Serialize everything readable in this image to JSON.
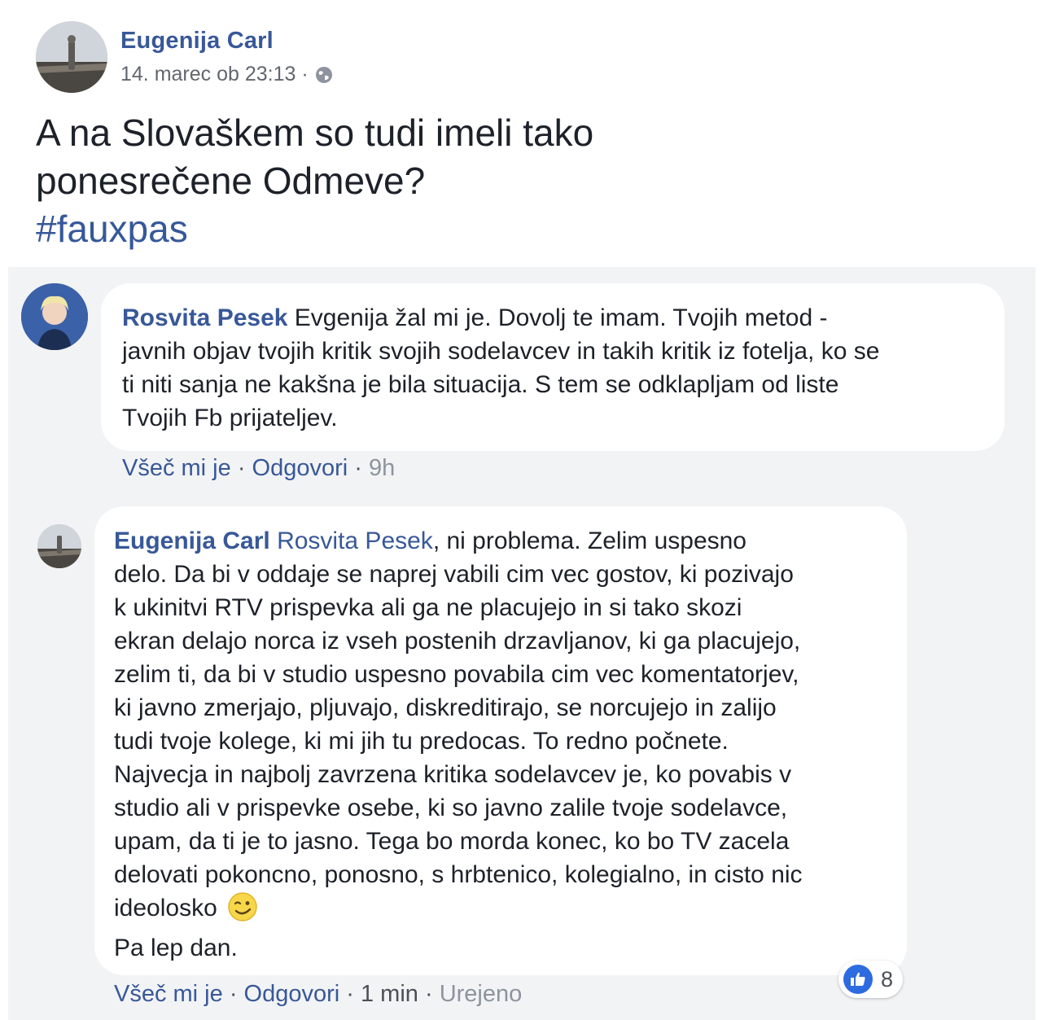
{
  "post": {
    "author": "Eugenija Carl",
    "timestamp": "14. marec ob 23:13 ·",
    "privacy_icon": "globe-icon",
    "text_line1": "A na Slovaškem so tudi imeli tako",
    "text_line2": "ponesrečene Odmeve?",
    "hashtag": "#fauxpas"
  },
  "comments": [
    {
      "author": "Rosvita Pesek",
      "lines": [
        "Evgenija žal mi je. Dovolj te imam. Tvojih metod -",
        "javnih objav tvojih kritik svojih sodelavcev in takih kritik iz fotelja, ko se",
        "ti niti sanja ne kakšna je bila situacija. S tem se odklapljam od liste",
        "Tvojih Fb prijateljev."
      ],
      "like_label": "Všeč mi je",
      "reply_label": "Odgovori",
      "time": "9h"
    },
    {
      "author": "Eugenija Carl",
      "mention": "Rosvita Pesek",
      "lines": [
        ", ni problema. Zelim uspesno",
        "delo. Da bi v oddaje se naprej vabili cim vec gostov, ki pozivajo",
        "k ukinitvi RTV prispevka ali ga ne placujejo in si tako skozi",
        "ekran delajo norca iz vseh postenih drzavljanov, ki ga placujejo,",
        "zelim ti, da bi v studio uspesno povabila cim vec komentatorjev,",
        "ki javno zmerjajo, pljuvajo, diskreditirajo, se norcujejo in zalijo",
        "tudi tvoje kolege, ki mi jih tu predocas. To redno počnete.",
        "Najvecja in najbolj zavrzena kritika sodelavcev je, ko povabis v",
        "studio ali v prispevke osebe, ki so javno zalile tvoje sodelavce,",
        "upam, da ti je to jasno. Tega bo morda konec, ko bo TV zacela",
        "delovati pokoncno, ponosno, s hrbtenico, kolegialno, in cisto nic",
        "ideolosko",
        "Pa lep dan."
      ],
      "emoji_icon": "wink-emoji-icon",
      "like_label": "Všeč mi je",
      "reply_label": "Odgovori",
      "time": "1 min",
      "edited": "Urejeno",
      "reaction_icon": "thumbs-up-icon",
      "reaction_count": "8"
    }
  ],
  "colors": {
    "name": "#385898",
    "comment_bg": "#f2f3f5",
    "like_blue": "#2d6be0"
  }
}
